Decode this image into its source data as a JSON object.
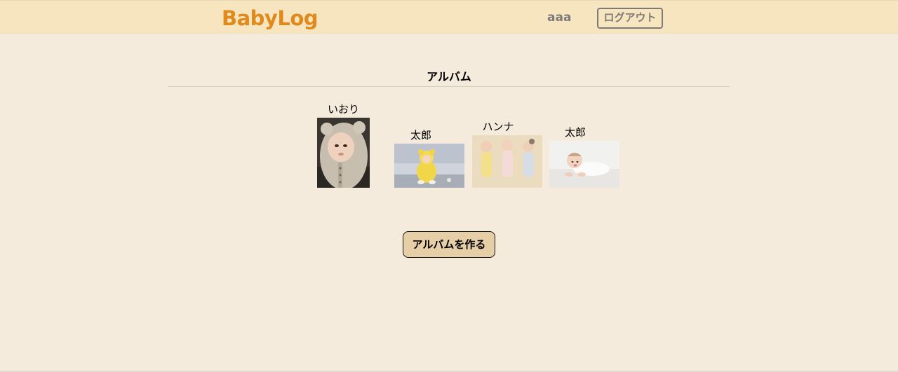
{
  "header": {
    "logo": "BabyLog",
    "username": "aaa",
    "logout_label": "ログアウト"
  },
  "main": {
    "title": "アルバム",
    "albums": [
      {
        "name": "いおり"
      },
      {
        "name": "太郎"
      },
      {
        "name": "ハンナ"
      },
      {
        "name": "太郎"
      }
    ],
    "create_label": "アルバムを作る"
  },
  "colors": {
    "page_background": "#f5ebdc",
    "header_background": "#f6e5bf",
    "logo": "#e08a1e",
    "muted_text": "#7d7b78",
    "button_background": "#e6cfa7"
  }
}
